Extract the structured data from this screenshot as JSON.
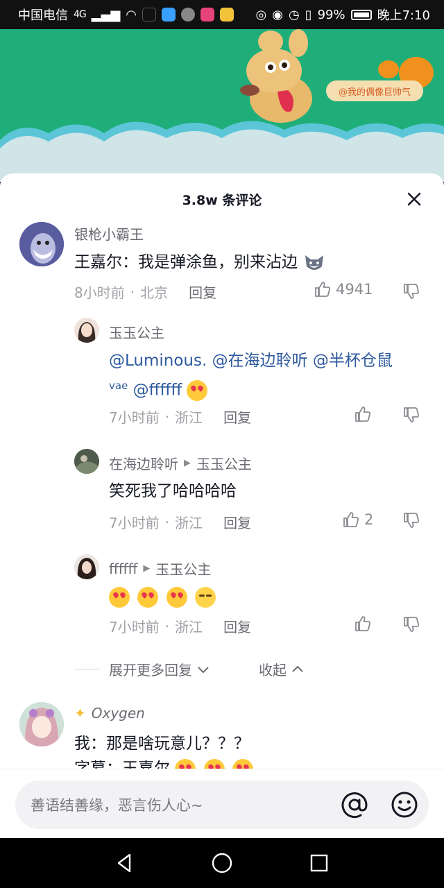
{
  "status_bar": {
    "carrier": "中国电信",
    "network": "4G",
    "battery": "99%",
    "time": "晚上7:10"
  },
  "banner": {
    "tag_text": "@我的偶像巨帅气"
  },
  "sheet": {
    "title": "3.8w 条评论"
  },
  "comments": [
    {
      "username": "银枪小霸王",
      "content": "王嘉尔：我是弹涂鱼，别来沾边",
      "time": "8小时前",
      "location": "北京",
      "reply_label": "回复",
      "likes": "4941"
    }
  ],
  "replies": [
    {
      "username": "玉玉公主",
      "mentions_line1": "@Luminous. @在海边聆听 @半杯仓鼠",
      "mentions_line2_sup": "vae",
      "mentions_line2": "@ffffff",
      "time": "7小时前",
      "location": "浙江",
      "reply_label": "回复",
      "likes": ""
    },
    {
      "username": "在海边聆听",
      "reply_to": "玉玉公主",
      "content": "笑死我了哈哈哈哈",
      "time": "7小时前",
      "location": "浙江",
      "reply_label": "回复",
      "likes": "2"
    },
    {
      "username": "ffffff",
      "reply_to": "玉玉公主",
      "time": "7小时前",
      "location": "浙江",
      "reply_label": "回复",
      "likes": ""
    }
  ],
  "expand": {
    "more_label": "展开更多回复",
    "collapse_label": "收起"
  },
  "comment2": {
    "username": "Oxygen",
    "content_line1": "我：那是啥玩意儿？？？",
    "content_line2": "字幕：王嘉尔"
  },
  "input": {
    "placeholder": "善语结善缘，恶言伤人心~"
  },
  "colors": {
    "banner_green": "#1fae7a",
    "mention_blue": "#2e5a9e"
  }
}
